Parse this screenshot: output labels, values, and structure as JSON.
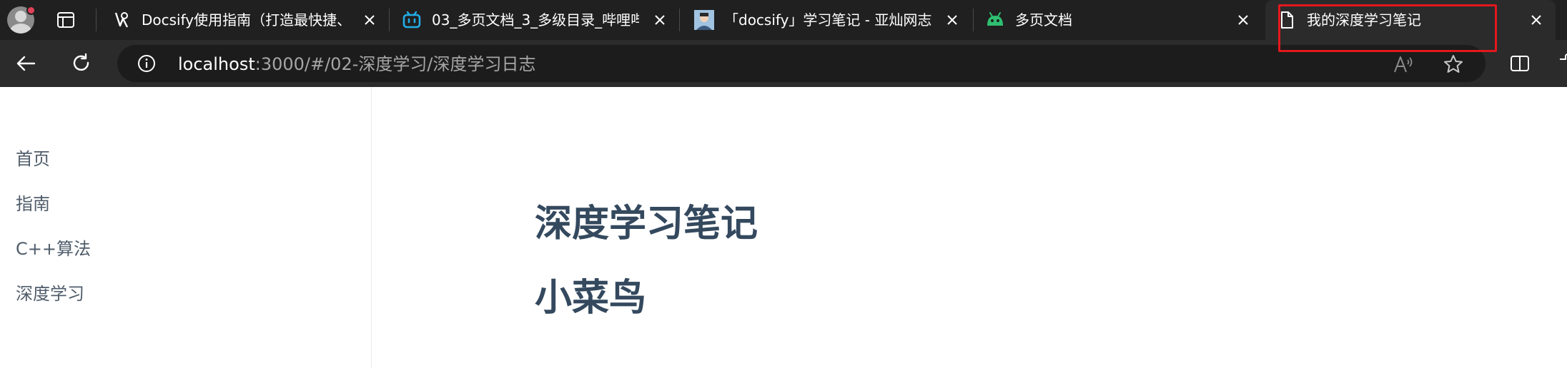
{
  "browser": {
    "tabs": [
      {
        "title": "Docsify使用指南（打造最快捷、",
        "icon": "docsify-icon",
        "active": false
      },
      {
        "title": "03_多页文档_3_多级目录_哔哩哔",
        "icon": "bilibili-icon",
        "active": false
      },
      {
        "title": "「docsify」学习笔记 - 亚灿网志",
        "icon": "blog-avatar-icon",
        "active": false
      },
      {
        "title": "多页文档",
        "icon": "android-icon",
        "active": false
      },
      {
        "title": "我的深度学习笔记",
        "icon": "document-icon",
        "active": true
      }
    ],
    "address": {
      "host": "localhost",
      "rest": ":3000/#/02-深度学习/深度学习日志"
    },
    "colors": {
      "tabstrip": "#202020",
      "toolbar": "#2b2b2b",
      "highlight": "#e3181d"
    }
  },
  "page": {
    "sidebar": {
      "items": [
        "首页",
        "指南",
        "C++算法",
        "深度学习"
      ]
    },
    "content": {
      "heading1": "深度学习笔记",
      "heading2": "小菜鸟"
    },
    "colors": {
      "heading": "#34495e",
      "sidebar_text": "#505d6b"
    }
  }
}
